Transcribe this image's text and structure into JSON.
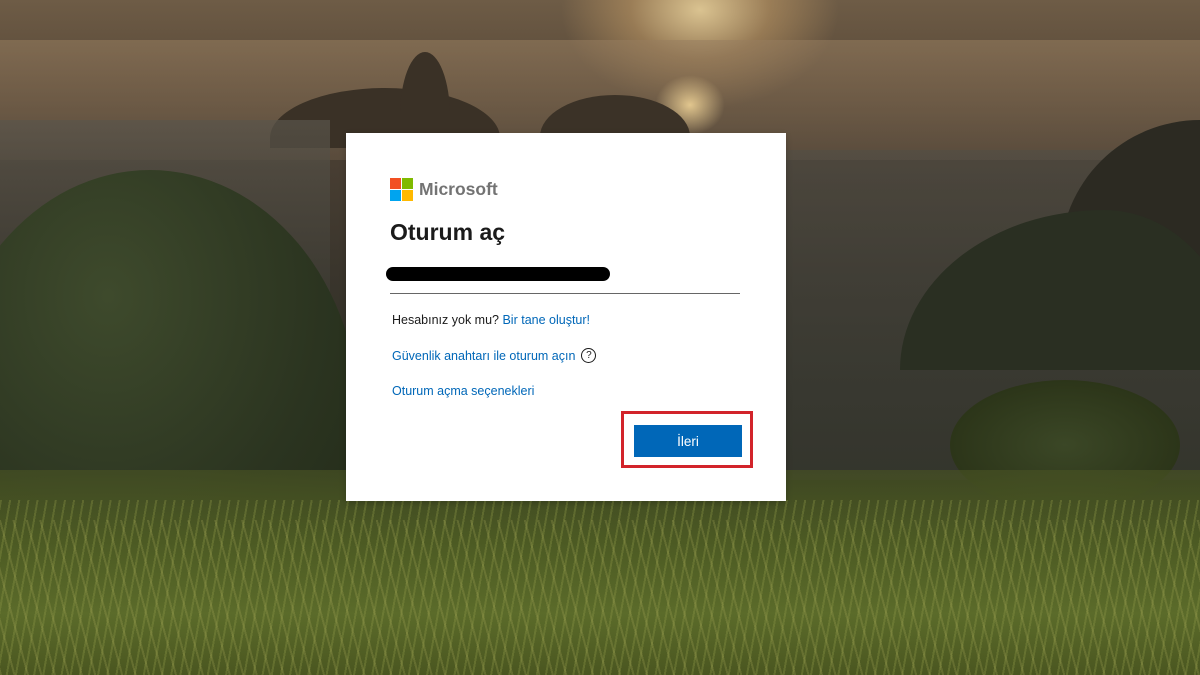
{
  "brand": {
    "name": "Microsoft",
    "logo_colors": [
      "#f25022",
      "#7fba00",
      "#00a4ef",
      "#ffb900"
    ]
  },
  "signin": {
    "title": "Oturum aç",
    "email_value": "",
    "no_account_text": "Hesabınız yok mu? ",
    "create_link": "Bir tane oluştur!",
    "security_key_link": "Güvenlik anahtarı ile oturum açın",
    "help_icon_glyph": "?",
    "signin_options_link": "Oturum açma seçenekleri",
    "next_button": "İleri"
  },
  "colors": {
    "accent": "#0067b8",
    "highlight": "#d2232a",
    "card": "#ffffff"
  }
}
